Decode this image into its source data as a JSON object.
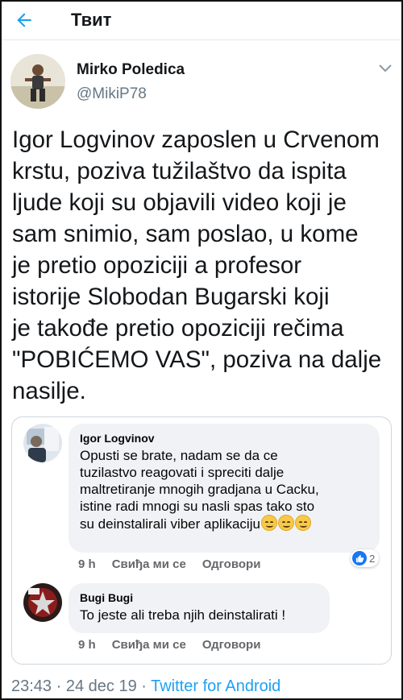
{
  "header": {
    "title": "Твит"
  },
  "author": {
    "name": "Mirko Poledica",
    "handle": "@MikiP78"
  },
  "tweet": {
    "lines": [
      "Igor Logvinov zaposlen u Crvenom",
      "krstu, poziva tužilaštvo da ispita",
      "ljude koji su objavili video koji je",
      "sam snimio, sam poslao, u kome",
      "je pretio opoziciji a profesor",
      "istorije Slobodan Bugarski koji",
      "je takođe pretio opoziciji rečima",
      "\"POBIĆEMO VAS\", poziva na dalje",
      "nasilje."
    ]
  },
  "card": {
    "comments": [
      {
        "name": "Igor Logvinov",
        "lines": [
          "Opusti se brate, nadam se da ce",
          "tuzilastvo reagovati i spreciti dalje",
          "maltretiranje mnogih gradjana u Cacku,",
          "istine radi mnogi su nasli spas tako sto",
          "su deinstalirali viber aplikaciju"
        ],
        "time": "9 h",
        "like": "Свиђа ми се",
        "reply": "Одговори",
        "reactions": "2"
      },
      {
        "name": "Bugi Bugi",
        "lines": [
          "To jeste ali treba njih deinstalirati !"
        ],
        "time": "9 h",
        "like": "Свиђа ми се",
        "reply": "Одговори"
      }
    ]
  },
  "footer": {
    "time": "23:43",
    "sep1": " · ",
    "date": "24 dec 19",
    "sep2": " · ",
    "source": "Twitter for Android"
  },
  "colors": {
    "accent": "#1da1f2",
    "secondary": "#657786",
    "facebook_blue": "#1877f2"
  }
}
